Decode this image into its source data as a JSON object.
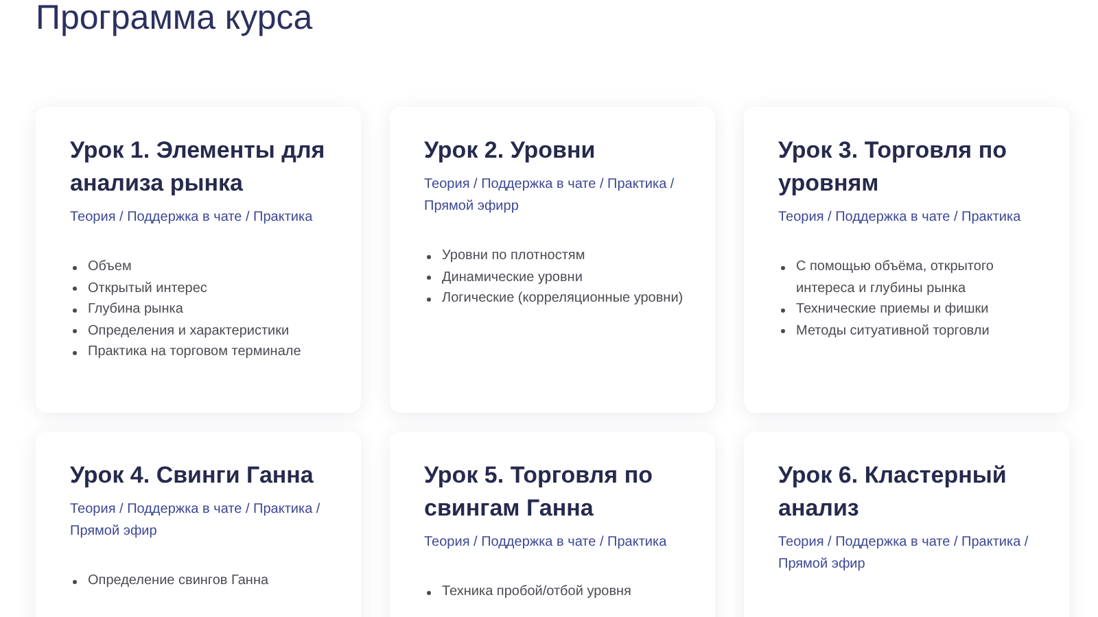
{
  "page_title": "Программа курса",
  "lessons": [
    {
      "title": "Урок 1. Элементы для анализа рынка",
      "formats": "Теория / Поддержка в чате / Практика",
      "topics": [
        "Объем",
        "Открытый интерес",
        "Глубина рынка",
        "Определения и характеристики",
        "Практика на торговом терминале"
      ]
    },
    {
      "title": "Урок 2. Уровни",
      "formats": "Теория / Поддержка в чате / Практика / Прямой эфирр",
      "topics": [
        "Уровни по плотностям",
        "Динамические уровни",
        "Логические (корреляционные уровни)"
      ]
    },
    {
      "title": "Урок 3. Торговля по уровням",
      "formats": "Теория / Поддержка в чате / Практика",
      "topics": [
        "С помощью объёма, открытого интереса и глубины рынка",
        "Технические приемы и фишки",
        "Методы ситуативной торговли"
      ]
    },
    {
      "title": "Урок 4. Свинги Ганна",
      "formats": "Теория / Поддержка в чате / Практика / Прямой эфир",
      "topics": [
        "Определение свингов Ганна"
      ]
    },
    {
      "title": "Урок 5. Торговля по свингам Ганна",
      "formats": "Теория / Поддержка в чате / Практика",
      "topics": [
        "Техника пробой/отбой уровня"
      ]
    },
    {
      "title": "Урок 6. Кластерный анализ",
      "formats": "Теория / Поддержка в чате / Практика / Прямой эфир"
    }
  ]
}
